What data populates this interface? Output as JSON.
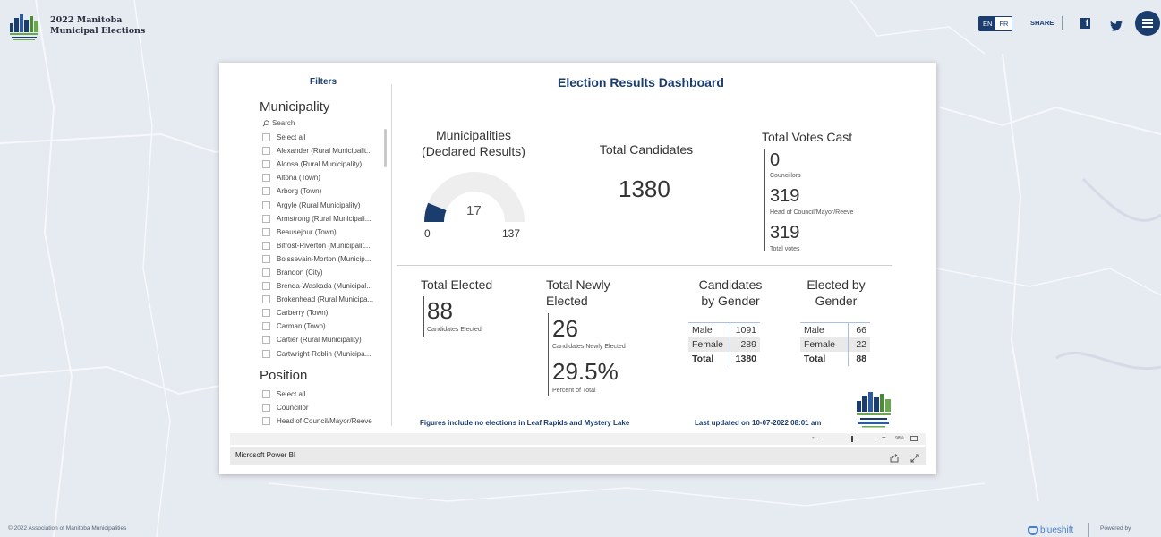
{
  "site": {
    "title_line1": "2022 Manitoba",
    "title_line2": "Municipal Elections",
    "lang": {
      "en": "EN",
      "fr": "FR"
    },
    "share": "SHARE",
    "facebook_glyph": "f",
    "copyright": "© 2022 Association of Manitoba Municipalities",
    "blueshift": "blueshift",
    "powered_by": "Powered by",
    "colors": {
      "navy": "#1b3d6e",
      "map_bg": "#e6eaf1"
    }
  },
  "report": {
    "dashboard_title": "Election Results Dashboard",
    "filters": {
      "title": "Filters",
      "municipality_heading": "Municipality",
      "search_placeholder": "Search",
      "municipalities": [
        "Select all",
        "Alexander (Rural Municipalit...",
        "Alonsa (Rural Municipality)",
        "Altona (Town)",
        "Arborg (Town)",
        "Argyle (Rural Municipality)",
        "Armstrong (Rural Municipali...",
        "Beausejour (Town)",
        "Bifrost-Riverton (Municipalit...",
        "Boissevain-Morton (Municip...",
        "Brandon (City)",
        "Brenda-Waskada (Municipal...",
        "Brokenhead (Rural Municipa...",
        "Carberry (Town)",
        "Carman (Town)",
        "Cartier (Rural Municipality)",
        "Cartwright-Roblin (Municipa..."
      ],
      "position_heading": "Position",
      "positions": [
        "Select all",
        "Councillor",
        "Head of Council/Mayor/Reeve"
      ]
    },
    "municipalities_kpi": {
      "label_line1": "Municipalities",
      "label_line2": "(Declared Results)",
      "value": "17",
      "min": "0",
      "max": "137",
      "fill_fraction": 0.124
    },
    "total_candidates": {
      "label": "Total Candidates",
      "value": "1380"
    },
    "total_votes": {
      "label": "Total Votes Cast",
      "councillors_value": "0",
      "councillors_label": "Councillors",
      "head_value": "319",
      "head_label": "Head of Council/Mayor/Reeve",
      "total_value": "319",
      "total_label": "Total votes"
    },
    "total_elected": {
      "label": "Total Elected",
      "value": "88",
      "sublabel": "Candidates Elected"
    },
    "newly_elected": {
      "label_line1": "Total Newly",
      "label_line2": "Elected",
      "value": "26",
      "sublabel": "Candidates Newly Elected",
      "percent": "29.5%",
      "percent_label": "Percent of Total"
    },
    "candidates_by_gender": {
      "label_line1": "Candidates",
      "label_line2": "by Gender",
      "rows": [
        {
          "gender": "Male",
          "value": "1091"
        },
        {
          "gender": "Female",
          "value": "289"
        },
        {
          "gender": "Total",
          "value": "1380"
        }
      ]
    },
    "elected_by_gender": {
      "label_line1": "Elected by",
      "label_line2": "Gender",
      "rows": [
        {
          "gender": "Male",
          "value": "66"
        },
        {
          "gender": "Female",
          "value": "22"
        },
        {
          "gender": "Total",
          "value": "88"
        }
      ]
    },
    "footnote": "Figures include no elections in Leaf Rapids and Mystery Lake",
    "last_updated": "Last updated on 10-07-2022 08:01 am",
    "zoom": {
      "minus": "-",
      "plus": "+",
      "percent": "98%"
    },
    "powerbi_label": "Microsoft Power BI"
  }
}
